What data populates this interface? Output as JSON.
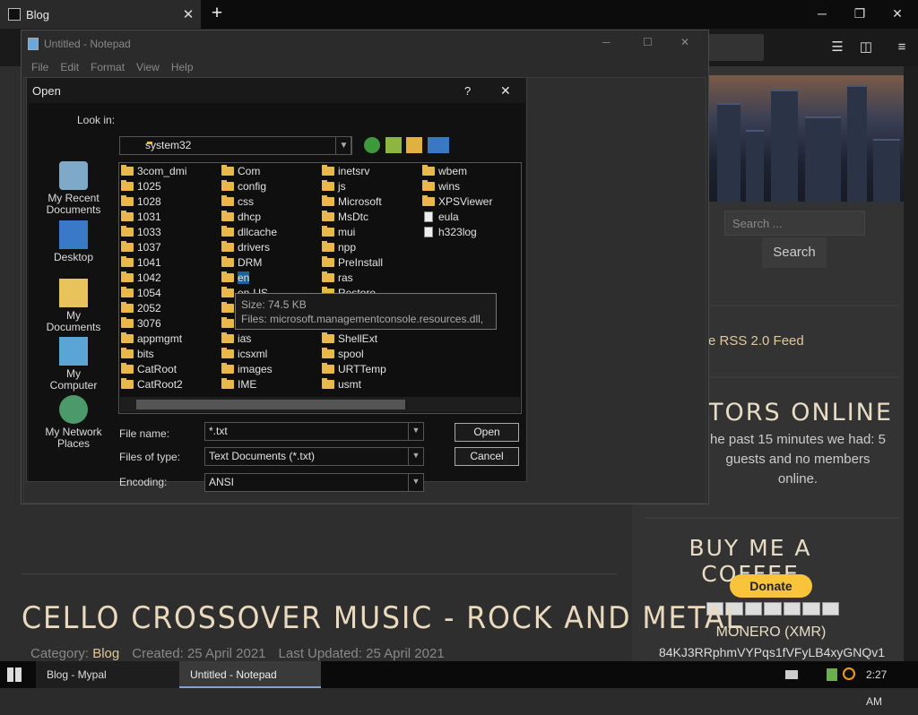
{
  "browser": {
    "tab_title": "Blog",
    "tab_close": "✕",
    "new_tab": "+",
    "window_controls": [
      "─",
      "❐",
      "✕"
    ]
  },
  "site": {
    "search_placeholder": "Search ...",
    "search_button": "Search",
    "rss": "e RSS 2.0 Feed",
    "visitors_title": "TORS ONLINE",
    "visitors_text": "he past 15 minutes we had: 5 guests and no members online.",
    "coffee_title": "BUY ME A COFFEE",
    "donate": "Donate",
    "monero": "MONERO (XMR)",
    "address": "84KJ3RRphmVYPqs1fVFyLB4xyGNQv1",
    "article_title": "CELLO CROSSOVER MUSIC - ROCK AND METAL",
    "meta": {
      "category_label": "Category:",
      "category_value": "Blog",
      "created": "Created: 25 April 2021",
      "updated": "Last Updated: 25 April 2021"
    }
  },
  "notepad": {
    "title": "Untitled - Notepad",
    "menu": [
      "File",
      "Edit",
      "Format",
      "View",
      "Help"
    ],
    "controls": [
      "─",
      "☐",
      "✕"
    ]
  },
  "dialog": {
    "title": "Open",
    "help": "?",
    "close": "✕",
    "look_in_label": "Look in:",
    "look_in_value": "system32",
    "places": [
      "My Recent Documents",
      "Desktop",
      "My Documents",
      "My Computer",
      "My Network Places"
    ],
    "columns": [
      [
        {
          "n": "3com_dmi",
          "t": "f"
        },
        {
          "n": "1025",
          "t": "f"
        },
        {
          "n": "1028",
          "t": "f"
        },
        {
          "n": "1031",
          "t": "f"
        },
        {
          "n": "1033",
          "t": "f"
        },
        {
          "n": "1037",
          "t": "f"
        },
        {
          "n": "1041",
          "t": "f"
        },
        {
          "n": "1042",
          "t": "f"
        },
        {
          "n": "1054",
          "t": "f"
        },
        {
          "n": "2052",
          "t": "f"
        },
        {
          "n": "3076",
          "t": "f"
        },
        {
          "n": "appmgmt",
          "t": "f"
        },
        {
          "n": "bits",
          "t": "f"
        },
        {
          "n": "CatRoot",
          "t": "f"
        },
        {
          "n": "CatRoot2",
          "t": "f"
        }
      ],
      [
        {
          "n": "Com",
          "t": "f"
        },
        {
          "n": "config",
          "t": "f"
        },
        {
          "n": "css",
          "t": "f"
        },
        {
          "n": "dhcp",
          "t": "f"
        },
        {
          "n": "dllcache",
          "t": "f"
        },
        {
          "n": "drivers",
          "t": "f"
        },
        {
          "n": "DRM",
          "t": "f"
        },
        {
          "n": "en",
          "t": "f",
          "sel": true
        },
        {
          "n": "en-US",
          "t": "f"
        },
        {
          "n": "",
          "t": "f"
        },
        {
          "n": "",
          "t": "f"
        },
        {
          "n": "ias",
          "t": "f"
        },
        {
          "n": "icsxml",
          "t": "f"
        },
        {
          "n": "images",
          "t": "f"
        },
        {
          "n": "IME",
          "t": "f"
        }
      ],
      [
        {
          "n": "inetsrv",
          "t": "f"
        },
        {
          "n": "js",
          "t": "f"
        },
        {
          "n": "Microsoft",
          "t": "f"
        },
        {
          "n": "MsDtc",
          "t": "f"
        },
        {
          "n": "mui",
          "t": "f"
        },
        {
          "n": "npp",
          "t": "f"
        },
        {
          "n": "PreInstall",
          "t": "f"
        },
        {
          "n": "ras",
          "t": "f"
        },
        {
          "n": "Restore",
          "t": "f"
        },
        {
          "n": "scripting",
          "t": "f"
        },
        {
          "n": "",
          "t": "f"
        },
        {
          "n": "ShellExt",
          "t": "f"
        },
        {
          "n": "spool",
          "t": "f"
        },
        {
          "n": "URTTemp",
          "t": "f"
        },
        {
          "n": "usmt",
          "t": "f"
        }
      ],
      [
        {
          "n": "wbem",
          "t": "f"
        },
        {
          "n": "wins",
          "t": "f"
        },
        {
          "n": "XPSViewer",
          "t": "f"
        },
        {
          "n": "eula",
          "t": "d"
        },
        {
          "n": "h323log",
          "t": "d"
        }
      ]
    ],
    "tooltip_size": "Size: 74.5 KB",
    "tooltip_files": "Files: microsoft.managementconsole.resources.dll, ...",
    "file_name_label": "File name:",
    "file_name_value": "*.txt",
    "files_of_type_label": "Files of type:",
    "files_of_type_value": "Text Documents (*.txt)",
    "encoding_label": "Encoding:",
    "encoding_value": "ANSI",
    "open_button": "Open",
    "cancel_button": "Cancel"
  },
  "taskbar": {
    "items": [
      "Blog - Mypal",
      "Untitled - Notepad"
    ],
    "clock": "2:27 AM"
  }
}
